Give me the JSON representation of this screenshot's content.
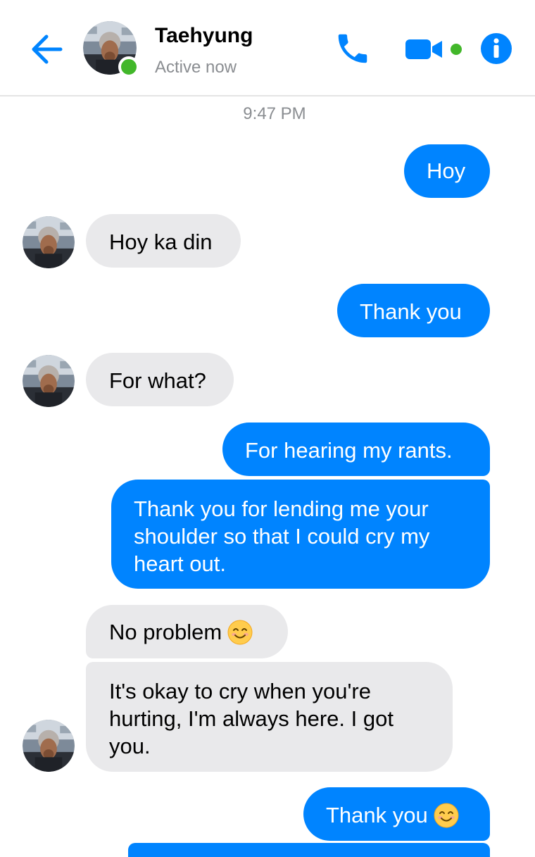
{
  "header": {
    "contact_name": "Taehyung",
    "status": "Active now"
  },
  "icons": {
    "back": "arrow-left-icon",
    "call": "phone-icon",
    "video": "video-camera-icon",
    "info": "info-icon",
    "emoji": "smiling-face-emoji"
  },
  "colors": {
    "accent": "#0084ff",
    "incoming_bubble": "#e9e9eb",
    "online": "#42b72a"
  },
  "timestamp": "9:47 PM",
  "messages": [
    {
      "from": "me",
      "text": "Hoy"
    },
    {
      "from": "contact",
      "text": "Hoy ka din"
    },
    {
      "from": "me",
      "text": "Thank you"
    },
    {
      "from": "contact",
      "text": "For what?"
    },
    {
      "from": "me",
      "text": "For hearing my rants."
    },
    {
      "from": "me",
      "text": "Thank you for lending me your shoulder so that I could cry my heart out."
    },
    {
      "from": "contact",
      "text": "No problem",
      "emoji": true
    },
    {
      "from": "contact",
      "text": "It's okay to cry when you're hurting, I'm always here. I got you."
    },
    {
      "from": "me",
      "text": "Thank you",
      "emoji": true
    }
  ]
}
